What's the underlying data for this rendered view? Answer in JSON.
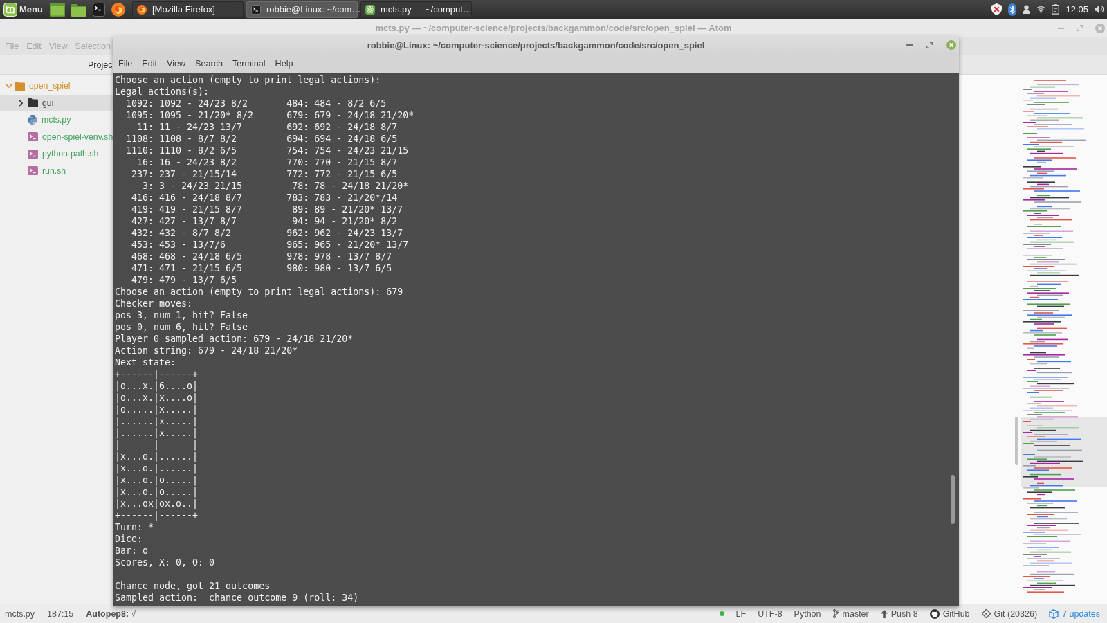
{
  "taskbar": {
    "menu_label": "Menu",
    "windows": [
      {
        "kind": "firefox",
        "label": "[Mozilla Firefox]",
        "selected": false
      },
      {
        "kind": "terminal",
        "label": "robbie@Linux: ~/com…",
        "selected": true
      },
      {
        "kind": "atom",
        "label": "mcts.py — ~/comput…",
        "selected": false
      }
    ],
    "clock": "12:05"
  },
  "atom": {
    "title": "mcts.py — ~/computer-science/projects/backgammon/code/src/open_spiel — Atom",
    "menu": [
      "File",
      "Edit",
      "View",
      "Selection"
    ],
    "dock_tab": "Projec",
    "tree": [
      {
        "label": "open_spiel",
        "kind": "folder",
        "expanded": true,
        "selected": false,
        "color": "#d4902c",
        "children": [
          {
            "label": "gui",
            "kind": "folder",
            "expanded": false,
            "selected": true,
            "color": "#333333"
          },
          {
            "label": "mcts.py",
            "kind": "python",
            "selected": false,
            "color": "#43a15e"
          },
          {
            "label": "open-spiel-venv.sh",
            "kind": "shell",
            "selected": false,
            "color": "#43a15e"
          },
          {
            "label": "python-path.sh",
            "kind": "shell",
            "selected": false,
            "color": "#43a15e"
          },
          {
            "label": "run.sh",
            "kind": "shell",
            "selected": false,
            "color": "#43a15e"
          }
        ]
      }
    ],
    "status_bar": {
      "left": [
        "mcts.py",
        "187:15",
        "**Autopep8:** √"
      ],
      "right": [
        {
          "kind": "dot"
        },
        {
          "kind": "text",
          "text": "LF"
        },
        {
          "kind": "text",
          "text": "UTF-8"
        },
        {
          "kind": "text",
          "text": "Python"
        },
        {
          "kind": "branch",
          "text": "master"
        },
        {
          "kind": "push",
          "text": "Push 8"
        },
        {
          "kind": "github",
          "text": "GitHub"
        },
        {
          "kind": "git",
          "text": "Git (20326)"
        },
        {
          "kind": "updates",
          "text": "7 updates"
        }
      ]
    }
  },
  "terminal": {
    "title": "robbie@Linux: ~/computer-science/projects/backgammon/code/src/open_spiel",
    "menu": [
      "File",
      "Edit",
      "View",
      "Search",
      "Terminal",
      "Help"
    ],
    "output": [
      {
        "kind": "line",
        "text": "Choose an action (empty to print legal actions):"
      },
      {
        "kind": "line",
        "text": "Legal actions(s):"
      },
      {
        "kind": "actions",
        "rows": [
          [
            "1092: 1092 - 24/23 8/2",
            "484: 484 - 8/2 6/5"
          ],
          [
            "1095: 1095 - 21/20* 8/2",
            "679: 679 - 24/18 21/20*"
          ],
          [
            "11: 11 - 24/23 13/7",
            "692: 692 - 24/18 8/7"
          ],
          [
            "1108: 1108 - 8/7 8/2",
            "694: 694 - 24/18 6/5"
          ],
          [
            "1110: 1110 - 8/2 6/5",
            "754: 754 - 24/23 21/15"
          ],
          [
            "16: 16 - 24/23 8/2",
            "770: 770 - 21/15 8/7"
          ],
          [
            "237: 237 - 21/15/14",
            "772: 772 - 21/15 6/5"
          ],
          [
            "3: 3 - 24/23 21/15",
            "78: 78 - 24/18 21/20*"
          ],
          [
            "416: 416 - 24/18 8/7",
            "783: 783 - 21/20*/14"
          ],
          [
            "419: 419 - 21/15 8/7",
            "89: 89 - 21/20* 13/7"
          ],
          [
            "427: 427 - 13/7 8/7",
            "94: 94 - 21/20* 8/2"
          ],
          [
            "432: 432 - 8/7 8/2",
            "962: 962 - 24/23 13/7"
          ],
          [
            "453: 453 - 13/7/6",
            "965: 965 - 21/20* 13/7"
          ],
          [
            "468: 468 - 24/18 6/5",
            "978: 978 - 13/7 8/7"
          ],
          [
            "471: 471 - 21/15 6/5",
            "980: 980 - 13/7 6/5"
          ],
          [
            "479: 479 - 13/7 6/5"
          ]
        ]
      },
      {
        "kind": "line",
        "text": "Choose an action (empty to print legal actions): 679"
      },
      {
        "kind": "line",
        "text": "Checker moves:"
      },
      {
        "kind": "line",
        "text": "pos 3, num 1, hit? False"
      },
      {
        "kind": "line",
        "text": "pos 0, num 6, hit? False"
      },
      {
        "kind": "line",
        "text": "Player 0 sampled action: 679 - 24/18 21/20*"
      },
      {
        "kind": "line",
        "text": "Action string: 679 - 24/18 21/20*"
      },
      {
        "kind": "line",
        "text": "Next state:"
      },
      {
        "kind": "board",
        "rows": [
          "+------|------+",
          "|o...x.|6....o|",
          "|o...x.|x....o|",
          "|o.....|x.....|",
          "|......|x.....|",
          "|......|x.....|",
          "|      |      |",
          "|x...o.|......|",
          "|x...o.|......|",
          "|x...o.|o.....|",
          "|x...o.|o.....|",
          "|x...ox|ox.o..|",
          "+------|------+"
        ]
      },
      {
        "kind": "line",
        "text": "Turn: *"
      },
      {
        "kind": "line",
        "text": "Dice:"
      },
      {
        "kind": "line",
        "text": "Bar: o"
      },
      {
        "kind": "line",
        "text": "Scores, X: 0, O: 0"
      },
      {
        "kind": "blank"
      },
      {
        "kind": "line",
        "text": "Chance node, got 21 outcomes"
      },
      {
        "kind": "line",
        "text": "Sampled action:  chance outcome 9 (roll: 34)"
      }
    ]
  }
}
